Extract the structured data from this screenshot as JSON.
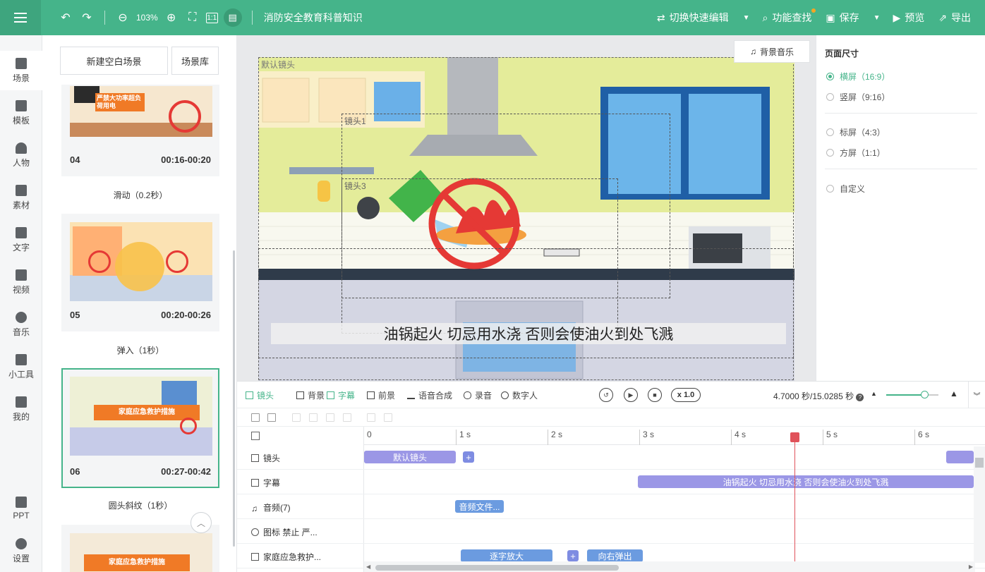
{
  "topbar": {
    "zoom": "103%",
    "title": "消防安全教育科普知识",
    "switch_edit": "切换快速编辑",
    "func_search": "功能查找",
    "save": "保存",
    "preview": "预览",
    "export": "导出"
  },
  "nav": {
    "items": [
      "场景",
      "模板",
      "人物",
      "素材",
      "文字",
      "视频",
      "音乐",
      "小工具",
      "我的",
      "PPT",
      "设置"
    ]
  },
  "scene_panel": {
    "new_scene": "新建空白场景",
    "library": "场景库",
    "cards": [
      {
        "num": "04",
        "time": "00:16-00:20",
        "badge": "严禁大功率超负荷用电",
        "transition": "滑动（0.2秒）"
      },
      {
        "num": "05",
        "time": "00:20-00:26",
        "badge": "",
        "transition": "弹入（1秒）"
      },
      {
        "num": "06",
        "time": "00:27-00:42",
        "badge": "家庭应急救护措施",
        "transition": "圆头斜纹（1秒）"
      },
      {
        "num": "",
        "time": "",
        "badge": "家庭应急救护措施",
        "transition": ""
      }
    ]
  },
  "canvas": {
    "bgm": "背景音乐",
    "default_cam": "默认镜头",
    "cam1": "镜头1",
    "cam3": "镜头3",
    "subtitle": "油锅起火 切忌用水浇 否则会使油火到处飞溅"
  },
  "right_panel": {
    "title": "页面尺寸",
    "options": [
      "横屏（16:9）",
      "竖屏（9:16）",
      "标屏（4:3）",
      "方屏（1:1）",
      "自定义"
    ]
  },
  "timeline": {
    "tabs": [
      "镜头",
      "背景",
      "字幕",
      "前景",
      "语音合成",
      "录音",
      "数字人"
    ],
    "speed": "x 1.0",
    "time": "4.7000 秒/15.0285 秒",
    "ticks": [
      "0",
      "1 s",
      "2 s",
      "3 s",
      "4 s",
      "5 s",
      "6 s"
    ],
    "tracks": [
      "镜头",
      "字幕",
      "音频(7)",
      "图标 禁止 严...",
      "家庭应急救护..."
    ],
    "clips": {
      "cam": "默认镜头",
      "subtitle": "油锅起火 切忌用水浇 否则会使油火到处飞溅",
      "audio": "音频文件...",
      "zoom": "逐字放大",
      "pop": "向右弹出"
    }
  }
}
